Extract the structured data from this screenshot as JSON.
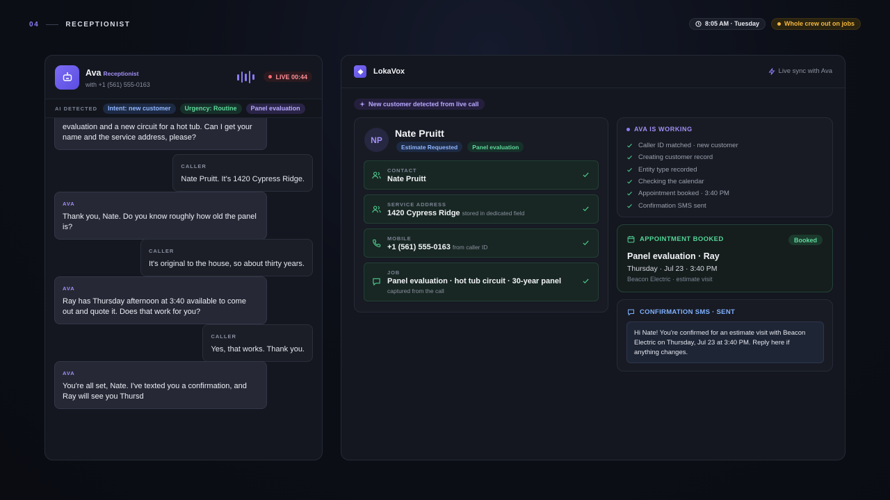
{
  "topbar": {
    "section_number": "04",
    "section_title": "RECEPTIONIST",
    "time": "8:05 AM · Tuesday",
    "crew_status": "Whole crew out on jobs",
    "colors": {
      "accent": "#8b7cf6",
      "warning": "#f5b740"
    }
  },
  "call": {
    "agent_name": "Ava",
    "agent_role": "Receptionist",
    "caller_line": "with +1 (561) 555-0163",
    "live_label": "LIVE 00:44",
    "detected_label": "AI DETECTED",
    "detected_tags": [
      "Intent: new customer",
      "Urgency: Routine",
      "Panel evaluation"
    ],
    "messages": [
      {
        "speaker": "",
        "text": "evaluation and a new circuit for a hot tub. Can I get your name and the service address, please?"
      },
      {
        "speaker": "CALLER",
        "text": "Nate Pruitt. It's 1420 Cypress Ridge."
      },
      {
        "speaker": "AVA",
        "text": "Thank you, Nate. Do you know roughly how old the panel is?"
      },
      {
        "speaker": "CALLER",
        "text": "It's original to the house, so about thirty years."
      },
      {
        "speaker": "AVA",
        "text": "Ray has Thursday afternoon at 3:40 available to come out and quote it. Does that work for you?"
      },
      {
        "speaker": "CALLER",
        "text": "Yes, that works. Thank you."
      },
      {
        "speaker": "AVA",
        "text": "You're all set, Nate. I've texted you a confirmation, and Ray will see you Thursd"
      }
    ]
  },
  "crm": {
    "app_name": "LokaVox",
    "sync_label": "Live sync with Ava",
    "new_customer_label": "New customer detected from live call",
    "customer": {
      "initials": "NP",
      "name": "Nate Pruitt",
      "tags": [
        "Estimate Requested",
        "Panel evaluation"
      ],
      "fields": [
        {
          "label": "CONTACT",
          "value": "Nate Pruitt",
          "note": "",
          "sub": "",
          "icon": "users-icon"
        },
        {
          "label": "SERVICE ADDRESS",
          "value": "1420 Cypress Ridge",
          "note": "stored in dedicated field",
          "sub": "",
          "icon": "users-icon"
        },
        {
          "label": "MOBILE",
          "value": "+1 (561) 555-0163",
          "note": "from caller ID",
          "sub": "",
          "icon": "phone-icon"
        },
        {
          "label": "JOB",
          "value": "Panel evaluation · hot tub circuit · 30-year panel",
          "note": "",
          "sub": "captured from the call",
          "icon": "message-icon"
        }
      ]
    },
    "working": {
      "title": "AVA IS WORKING",
      "steps": [
        "Caller ID matched · new customer",
        "Creating customer record",
        "Entity type recorded",
        "Checking the calendar",
        "Appointment booked · 3:40 PM",
        "Confirmation SMS sent"
      ]
    },
    "appointment": {
      "title": "APPOINTMENT BOOKED",
      "badge": "Booked",
      "headline": "Panel evaluation · Ray",
      "when": "Thursday · Jul 23 · 3:40 PM",
      "who": "Beacon Electric · estimate visit"
    },
    "sms": {
      "title": "CONFIRMATION SMS · SENT",
      "body": "Hi Nate! You're confirmed for an estimate visit with Beacon Electric on Thursday, Jul 23 at 3:40 PM. Reply here if anything changes."
    }
  }
}
